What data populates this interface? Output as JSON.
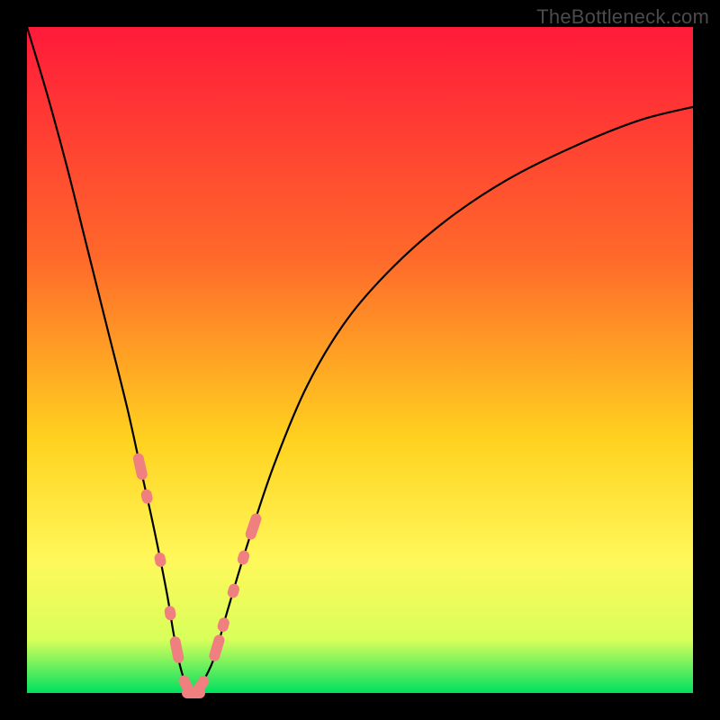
{
  "watermark": {
    "text": "TheBottleneck.com"
  },
  "colors": {
    "top": "#ff1a3a",
    "mid1": "#ff6a2a",
    "mid2": "#ffd21f",
    "mid3": "#fff85a",
    "mid4": "#d8ff5a",
    "bottom": "#00e060",
    "curve": "#000000",
    "marker": "#f08080"
  },
  "chart_data": {
    "type": "line",
    "title": "",
    "xlabel": "",
    "ylabel": "",
    "xlim": [
      0,
      100
    ],
    "ylim": [
      0,
      100
    ],
    "x": [
      0,
      3,
      6,
      9,
      12,
      15,
      17,
      19,
      21,
      22,
      23,
      24,
      25,
      26,
      28,
      30,
      33,
      37,
      42,
      48,
      55,
      63,
      72,
      82,
      92,
      100
    ],
    "y": [
      100,
      90,
      79,
      67,
      55,
      43,
      34,
      25,
      15,
      9,
      4,
      1,
      0,
      1,
      5,
      12,
      22,
      34,
      46,
      56,
      64,
      71,
      77,
      82,
      86,
      88
    ],
    "markers": {
      "comment": "salmon pill-shaped marker clusters near the valley (x positions, 0-100 scale)",
      "left_cluster": [
        17,
        18,
        20,
        21.5,
        22.5
      ],
      "bottom_cluster": [
        24,
        25,
        26
      ],
      "right_cluster": [
        28.5,
        29.5,
        31,
        32.5,
        34
      ]
    }
  }
}
